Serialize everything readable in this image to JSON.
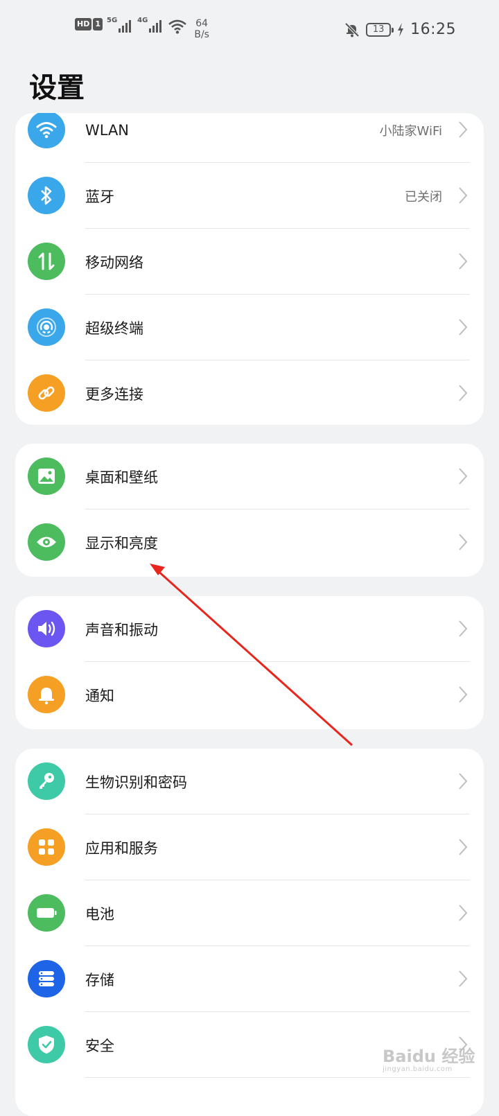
{
  "status_bar": {
    "hd_label": "HD",
    "sim_label": "1",
    "network_1": "5G",
    "network_2": "4G",
    "speed_value": "64",
    "speed_unit": "B/s",
    "battery_level": "13",
    "time": "16:25"
  },
  "page_title": "设置",
  "groups": [
    {
      "items": [
        {
          "label": "WLAN",
          "value": "小陆家WiFi",
          "icon": "wifi-icon",
          "color": "#3aa7ea"
        },
        {
          "label": "蓝牙",
          "value": "已关闭",
          "icon": "bluetooth-icon",
          "color": "#3aa7ea"
        },
        {
          "label": "移动网络",
          "value": "",
          "icon": "mobile-network-icon",
          "color": "#4cbc5f"
        },
        {
          "label": "超级终端",
          "value": "",
          "icon": "super-device-icon",
          "color": "#3aa7ea"
        },
        {
          "label": "更多连接",
          "value": "",
          "icon": "link-icon",
          "color": "#f5a024"
        }
      ]
    },
    {
      "items": [
        {
          "label": "桌面和壁纸",
          "value": "",
          "icon": "wallpaper-icon",
          "color": "#4cbc5f"
        },
        {
          "label": "显示和亮度",
          "value": "",
          "icon": "eye-icon",
          "color": "#4cbc5f"
        }
      ]
    },
    {
      "items": [
        {
          "label": "声音和振动",
          "value": "",
          "icon": "speaker-icon",
          "color": "#6b56f2"
        },
        {
          "label": "通知",
          "value": "",
          "icon": "bell-icon",
          "color": "#f5a024"
        }
      ]
    },
    {
      "items": [
        {
          "label": "生物识别和密码",
          "value": "",
          "icon": "key-icon",
          "color": "#3ec9a7"
        },
        {
          "label": "应用和服务",
          "value": "",
          "icon": "apps-icon",
          "color": "#f5a024"
        },
        {
          "label": "电池",
          "value": "",
          "icon": "battery-icon",
          "color": "#4cbc5f"
        },
        {
          "label": "存储",
          "value": "",
          "icon": "storage-icon",
          "color": "#1e64e6"
        },
        {
          "label": "安全",
          "value": "",
          "icon": "shield-icon",
          "color": "#3ec9a7"
        }
      ]
    }
  ],
  "watermark": {
    "brand": "Baidu 经验",
    "url": "jingyan.baidu.com"
  }
}
